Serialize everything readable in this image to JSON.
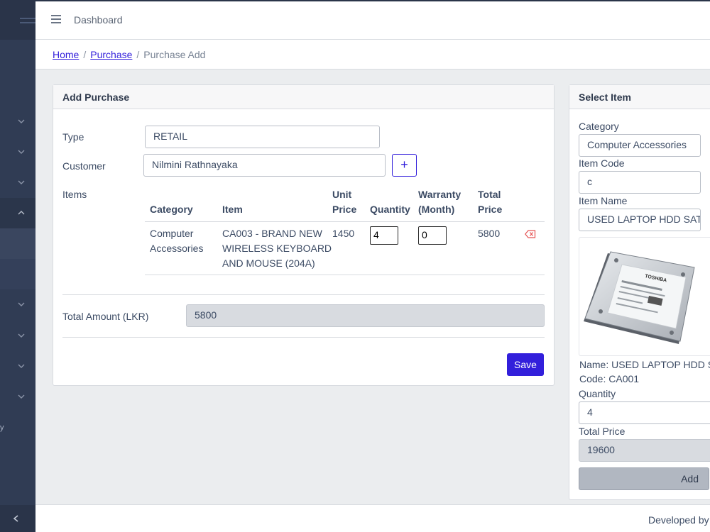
{
  "header": {
    "title": "Dashboard"
  },
  "breadcrumb": {
    "home": "Home",
    "purchase": "Purchase",
    "current": "Purchase Add",
    "separator": "/"
  },
  "purchase_form": {
    "card_title": "Add Purchase",
    "type_label": "Type",
    "type_value": "RETAIL",
    "customer_label": "Customer",
    "customer_value": "Nilmini Rathnayaka",
    "add_customer_symbol": "+",
    "items_label": "Items",
    "columns": {
      "category": "Category",
      "item": "Item",
      "unit_price_1": "Unit",
      "unit_price_2": "Price",
      "quantity": "Quantity",
      "warranty_1": "Warranty",
      "warranty_2": "(Month)",
      "total_price_1": "Total",
      "total_price_2": "Price"
    },
    "rows": [
      {
        "category_1": "Computer",
        "category_2": "Accessories",
        "item_1": "CA003 - BRAND NEW",
        "item_2": "WIRELESS KEYBOARD",
        "item_3": "AND MOUSE (204A)",
        "unit_price": "1450",
        "quantity": "4",
        "warranty": "0",
        "total_price": "5800"
      }
    ],
    "total_label": "Total Amount (LKR)",
    "total_value": "5800",
    "save_label": "Save"
  },
  "select_item": {
    "card_title": "Select Item",
    "category_label": "Category",
    "category_value": "Computer Accessories",
    "item_code_label": "Item Code",
    "item_code_value": "c",
    "item_name_label": "Item Name",
    "item_name_value": "USED LAPTOP HDD SAT",
    "name_line": "Name: USED LAPTOP HDD SA",
    "code_line": "Code: CA001",
    "quantity_label": "Quantity",
    "quantity_value": "4",
    "total_price_label": "Total Price",
    "total_price_value": "19600",
    "add_label": "Add",
    "hdd_brand": "TOSHIBA"
  },
  "sidebar": {
    "stray_letter": "y"
  },
  "footer": {
    "text": "Developed by"
  },
  "colors": {
    "primary": "#321fdb",
    "sidebar": "#303c54",
    "danger": "#e55353",
    "body_bg": "#ebedef"
  }
}
